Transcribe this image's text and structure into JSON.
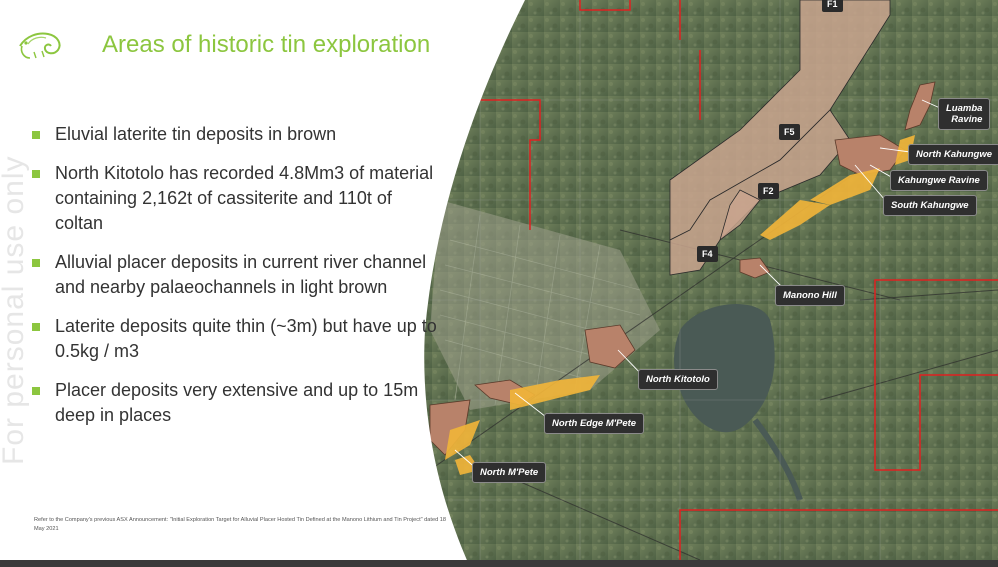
{
  "slide": {
    "title": "Areas of historic tin exploration",
    "watermark": "For personal use only",
    "bullets": [
      "Eluvial laterite tin deposits in brown",
      "North Kitotolo has recorded 4.8Mm3 of material containing 2,162t of cassiterite and 110t of coltan",
      "Alluvial placer deposits in current river channel and nearby palaeochannels in light brown",
      "Laterite deposits quite thin (~3m) but have up to 0.5kg / m3",
      "Placer deposits very extensive and up to 15m deep in places"
    ],
    "footnote": "Refer to the Company's previous ASX Announcement: \"Initial Exploration Target for Alluvial Placer Hosted Tin Defined at the Manono Lithium and Tin Project\" dated 18 May 2021",
    "accent_color": "#8cc63f",
    "logo_icon": "chameleon-logo-icon"
  },
  "map": {
    "place_labels": {
      "luamba": "Luamba\nRavine",
      "north_kahungwe": "North Kahungwe",
      "kahungwe_ravine": "Kahungwe Ravine",
      "south_kahungwe": "South Kahungwe",
      "manono_hill": "Manono Hill",
      "north_kitotolo": "North Kitotolo",
      "north_edge_mpete": "North Edge M'Pete",
      "north_mpete": "North M'Pete"
    },
    "block_labels": {
      "f1": "F1",
      "f5": "F5",
      "f2": "F2",
      "f4": "F4"
    },
    "colors": {
      "laterite": "#c9a48e",
      "placer": "#f0b43a",
      "tenement_boundary": "#e02020",
      "label_bg": "#2f2f2f"
    }
  }
}
